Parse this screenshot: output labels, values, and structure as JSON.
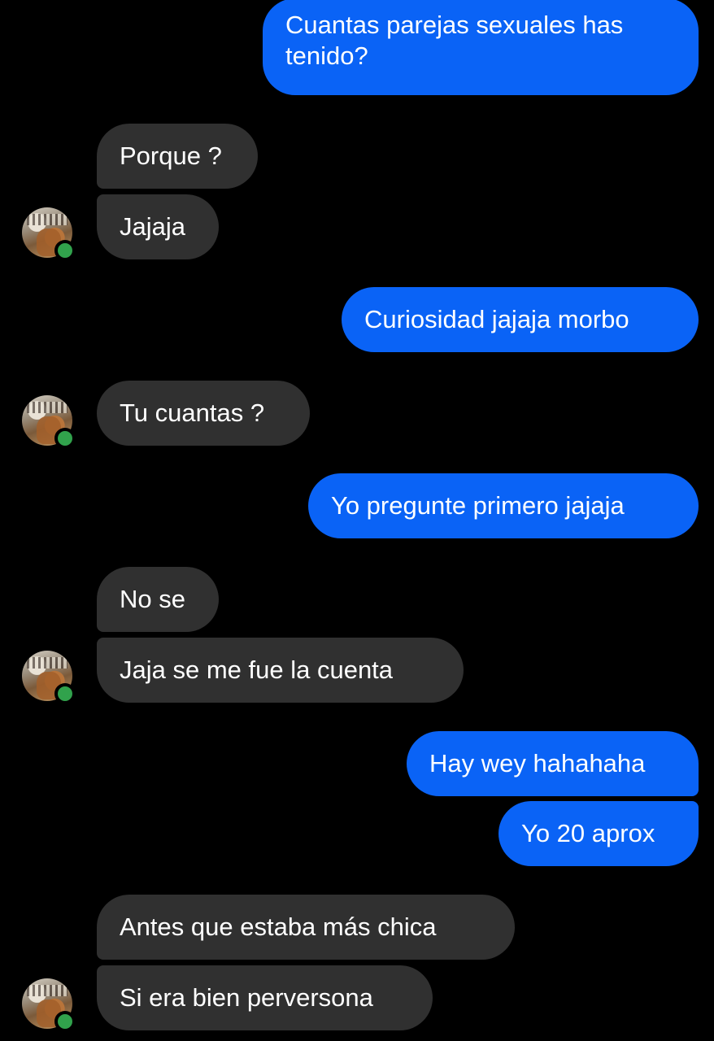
{
  "messages": {
    "m1": "Cuantas parejas sexuales has tenido?",
    "m2": "Porque ?",
    "m3": "Jajaja",
    "m4": "Curiosidad jajaja morbo",
    "m5": "Tu cuantas ?",
    "m6": "Yo pregunte primero jajaja",
    "m7": "No se",
    "m8": "Jaja se me fue la cuenta",
    "m9": "Hay wey hahahaha",
    "m10": "Yo 20 aprox",
    "m11": "Antes que estaba más chica",
    "m12": "Si era bien perversona"
  },
  "colors": {
    "background": "#000000",
    "outgoing_bubble": "#0a63f6",
    "incoming_bubble": "#303030",
    "online_indicator": "#31a24c"
  },
  "contact": {
    "avatar_icon": "contact-avatar-icon",
    "status": "online"
  }
}
